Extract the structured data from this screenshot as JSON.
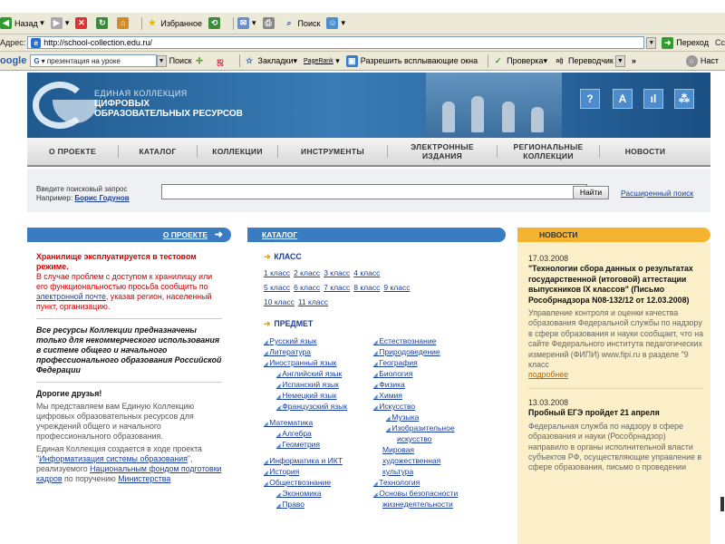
{
  "browser": {
    "nav": {
      "back": "Назад",
      "favorites": "Избранное",
      "search": "Поиск"
    },
    "address_label": "Адрес:",
    "url": "http://school-collection.edu.ru/",
    "go": "Переход",
    "go_suffix": "Сс",
    "google_logo": "oogle",
    "google_g": "G",
    "google_query": "презентация на уроке",
    "google_search": "Поиск",
    "bookmarks": "Закладки",
    "pagerank": "PageRank",
    "popups": "Разрешить всплывающие окна",
    "check": "Проверка",
    "translate": "Переводчик",
    "more": "»",
    "settings": "Наст"
  },
  "site": {
    "name_line1": "ЕДИНАЯ КОЛЛЕКЦИЯ",
    "name_line2": "ЦИФРОВЫХ",
    "name_line3": "ОБРАЗОВАТЕЛЬНЫХ РЕСУРСОВ",
    "header_icons": [
      "?",
      "A",
      "ıl",
      "⁂"
    ]
  },
  "nav": [
    {
      "label": "О ПРОЕКТЕ"
    },
    {
      "label": "КАТАЛОГ"
    },
    {
      "label": "КОЛЛЕКЦИИ"
    },
    {
      "label": "ИНСТРУМЕНТЫ"
    },
    {
      "label": "ЭЛЕКТРОННЫЕ ИЗДАНИЯ"
    },
    {
      "label": "РЕГИОНАЛЬНЫЕ КОЛЛЕКЦИИ"
    },
    {
      "label": "НОВОСТИ"
    }
  ],
  "search": {
    "hint": "Введите поисковый запрос",
    "example_label": "Например:",
    "example": "Борис Годунов",
    "button": "Найти",
    "advanced": "Расширенный поиск"
  },
  "left": {
    "bar": "О ПРОЕКТЕ",
    "warning_title": "Хранилище эксплуатируется в тестовом режиме.",
    "warning_p1": "В случае проблем с доступом к хранилищу или его функциональностью просьба сообщить по",
    "warning_link": "электронной почте",
    "warning_p2": ", указав регион, населенный пункт, организацию.",
    "italic": "Все ресурсы Коллекции предназначены только для некоммерческого использования в системе общего и начального профессионального образования Российской Федерации",
    "greeting": "Дорогие друзья!",
    "p1": "Мы представляем вам Единую Коллекцию цифровых образовательных ресурсов для учреждений общего и начального профессионального образования.",
    "p2a": "Единая Коллекция создается в ходе проекта \"",
    "p2link": "Информатизация системы образования",
    "p2b": "\", реализуемого",
    "p2link2": "Национальным фондом подготовки кадров",
    "p2c": " по поручению ",
    "p2link3": "Министерства"
  },
  "middle": {
    "bar": "КАТАЛОГ",
    "class_title": "КЛАСС",
    "classes_row1": [
      "1 класс",
      "2 класс",
      "3 класс",
      "4 класс"
    ],
    "classes_row2": [
      "5 класс",
      "6 класс",
      "7 класс",
      "8 класс",
      "9 класс"
    ],
    "classes_row3": [
      "10 класс",
      "11 класс"
    ],
    "subject_title": "ПРЕДМЕТ",
    "subjects_left": [
      {
        "label": "Русский язык",
        "level": 1
      },
      {
        "label": "Литература",
        "level": 1
      },
      {
        "label": "Иностранный язык",
        "level": 1
      },
      {
        "label": "Английский язык",
        "level": 2
      },
      {
        "label": "Испанский язык",
        "level": 2
      },
      {
        "label": "Немецкий язык",
        "level": 2
      },
      {
        "label": "Французский язык",
        "level": 2
      },
      {
        "label": "Математика",
        "level": 1
      },
      {
        "label": "Алгебра",
        "level": 2
      },
      {
        "label": "Геометрия",
        "level": 2
      },
      {
        "label": "Информатика и ИКТ",
        "level": 1
      },
      {
        "label": "История",
        "level": 1
      },
      {
        "label": "Обществознание",
        "level": 1
      },
      {
        "label": "Экономика",
        "level": 2
      },
      {
        "label": "Право",
        "level": 2
      }
    ],
    "subjects_right": [
      {
        "label": "Естествознание",
        "level": 1
      },
      {
        "label": "Природоведение",
        "level": 1
      },
      {
        "label": "География",
        "level": 1
      },
      {
        "label": "Биология",
        "level": 1
      },
      {
        "label": "Физика",
        "level": 1
      },
      {
        "label": "Химия",
        "level": 1
      },
      {
        "label": "Искусство",
        "level": 1
      },
      {
        "label": "Музыка",
        "level": 2
      },
      {
        "label": "Изобразительное",
        "level": 2
      },
      {
        "label": "искусство",
        "level": 3
      },
      {
        "label": "Мировая",
        "level": 4
      },
      {
        "label": "художественная",
        "level": 4
      },
      {
        "label": "культура",
        "level": 4
      },
      {
        "label": "Технология",
        "level": 1
      },
      {
        "label": "Основы безопасности",
        "level": 1
      },
      {
        "label": "жизнедеятельности",
        "level": 4
      }
    ]
  },
  "right": {
    "bar": "НОВОСТИ",
    "n1_date": "17.03.2008",
    "n1_title": "\"Технологии сбора данных о результатах государственной (итоговой) аттестации выпускников IX классов\" (Письмо Рособрнадзора N08-132/12 от 12.03.2008)",
    "n1_body": "Управление контроля и оценки качества образования Федеральной службы по надзору в сфере образования и науки сообщает, что на сайте Федерального института педагогических измерений (ФИПИ) www.fipi.ru в разделе \"9 класс",
    "n1_more": "подробнее",
    "n2_date": "13.03.2008",
    "n2_title": "Пробный ЕГЭ пройдет 21 апреля",
    "n2_body": "Федеральная служба по надзору в сфере образования и науки (Рособрнадзор) направило в органы исполнительной власти субъектов РФ, осуществляющие управление в сфере образования, письмо о проведении"
  }
}
